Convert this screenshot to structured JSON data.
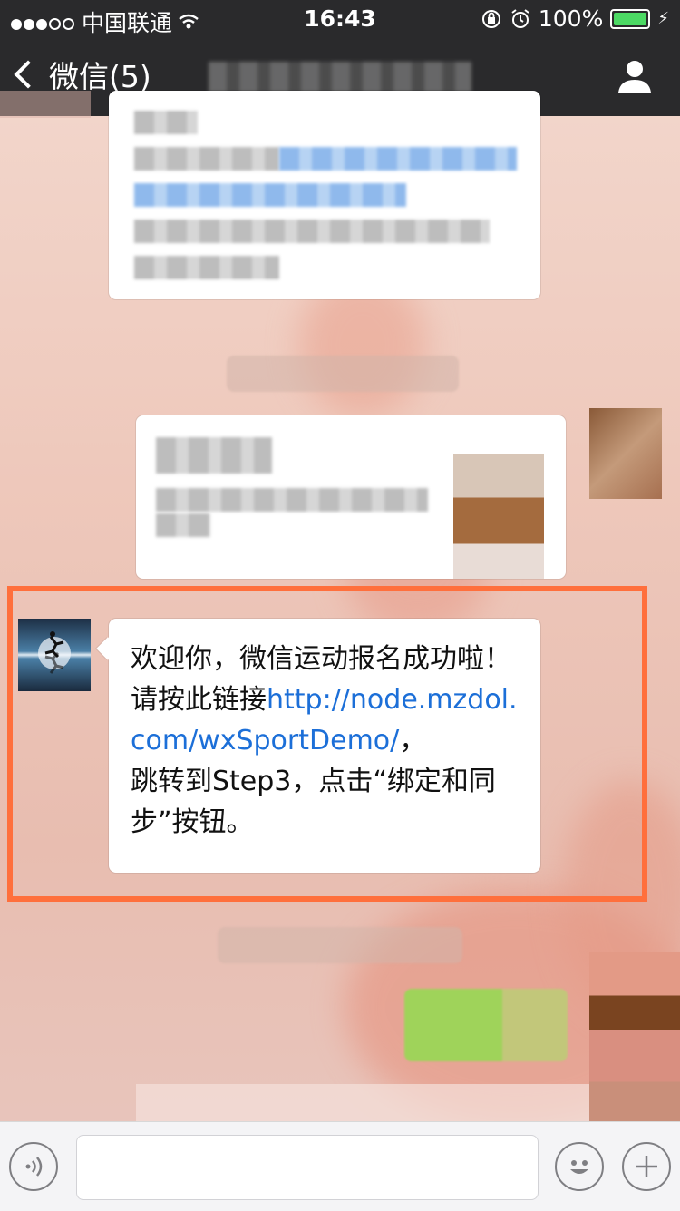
{
  "status_bar": {
    "carrier": "中国联通",
    "time": "16:43",
    "battery": "100%",
    "signal_bars": [
      true,
      true,
      true,
      false,
      false
    ],
    "battery_level": 1.0,
    "battery_color": "#4cd964"
  },
  "nav": {
    "back_label": "微信(5)",
    "chat_title": "",
    "profile_icon": "person-icon"
  },
  "messages": {
    "highlighted": {
      "line1": "欢迎你，微信运动报名成功啦！",
      "line2_prefix": "请按此链接",
      "link": "http://node.mzdol.com/wxSportDemo/",
      "line2_suffix": "，",
      "line3": "跳转到Step3，点击“绑定和同步”按钮。"
    }
  },
  "input_bar": {
    "voice_icon": "voice-icon",
    "emoji_icon": "emoji-icon",
    "plus_icon": "plus-icon"
  },
  "colors": {
    "nav_bg": "#2a2a2c",
    "highlight_border": "#ff6f3c",
    "link": "#1c6fd8",
    "sent_bubble": "#9fd35a"
  }
}
